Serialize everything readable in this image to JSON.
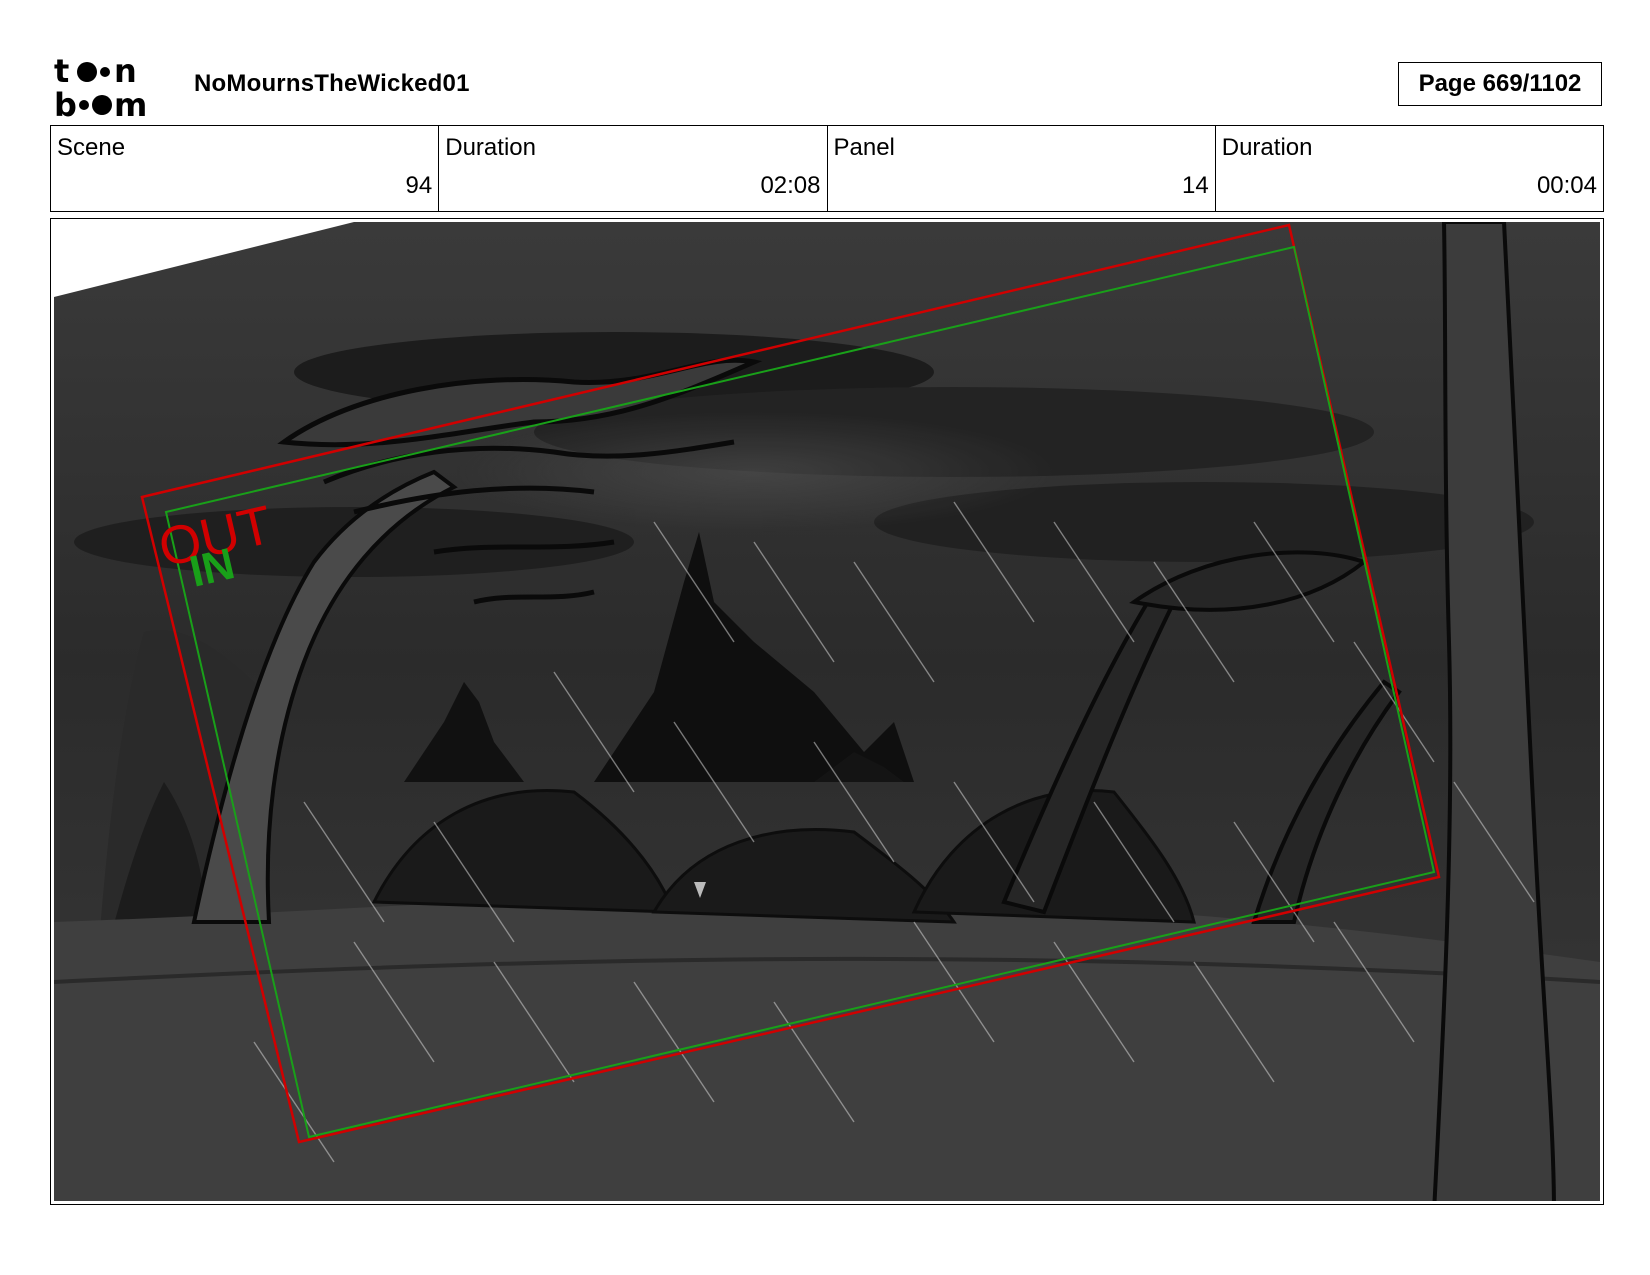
{
  "header": {
    "logo_text": "toonboom",
    "project_title": "NoMournsTheWicked01",
    "page_label": "Page",
    "page_value": "669/1102"
  },
  "info": {
    "scene_label": "Scene",
    "scene_value": "94",
    "scene_duration_label": "Duration",
    "scene_duration_value": "02:08",
    "panel_label": "Panel",
    "panel_value": "14",
    "panel_duration_label": "Duration",
    "panel_duration_value": "00:04"
  },
  "panel_image": {
    "description_icon": "storyboard-sketch",
    "camera_out_label": "OUT",
    "camera_in_label": "IN",
    "out_color": "#d10000",
    "in_color": "#19a019"
  }
}
